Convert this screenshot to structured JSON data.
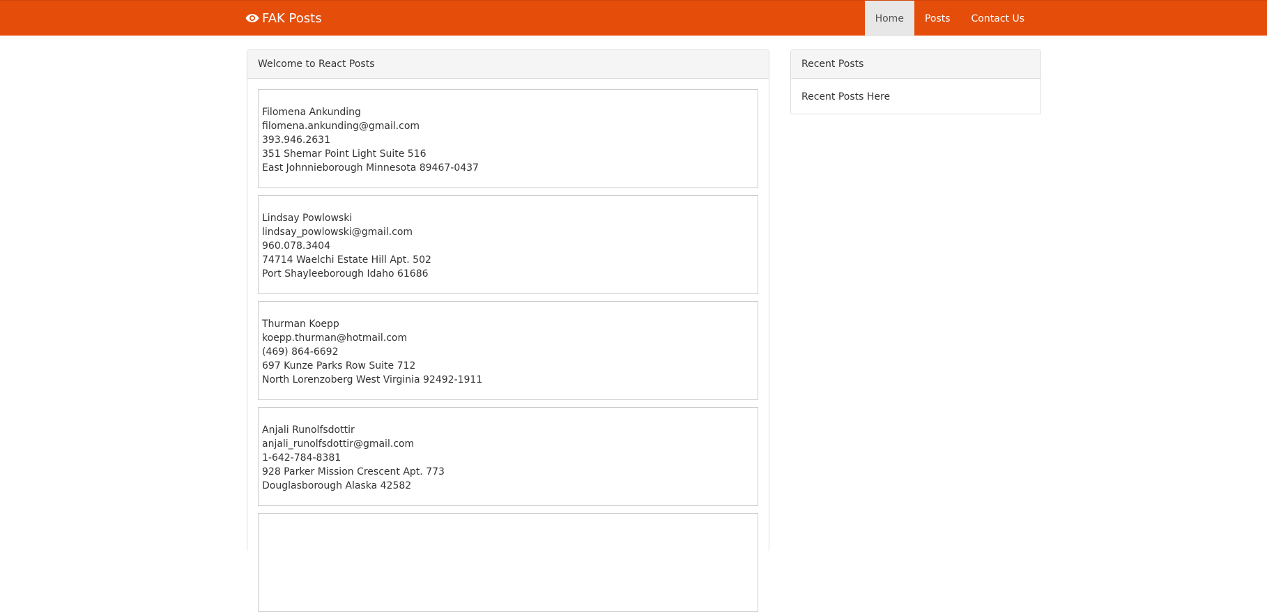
{
  "navbar": {
    "brand_label": "FAK Posts",
    "brand_icon": "eye-icon",
    "color": "#e44d0a",
    "items": [
      {
        "label": "Home",
        "active": true
      },
      {
        "label": "Posts",
        "active": false
      },
      {
        "label": "Contact Us",
        "active": false
      }
    ]
  },
  "main": {
    "heading": "Welcome to React Posts",
    "users": [
      {
        "name": "Filomena Ankunding",
        "email": "filomena.ankunding@gmail.com",
        "phone": "393.946.2631",
        "street": "351 Shemar Point Light Suite 516",
        "city_line": "East Johnnieborough Minnesota 89467-0437"
      },
      {
        "name": "Lindsay Powlowski",
        "email": "lindsay_powlowski@gmail.com",
        "phone": "960.078.3404",
        "street": "74714 Waelchi Estate Hill Apt. 502",
        "city_line": "Port Shayleeborough Idaho 61686"
      },
      {
        "name": "Thurman Koepp",
        "email": "koepp.thurman@hotmail.com",
        "phone": "(469) 864-6692",
        "street": "697 Kunze Parks Row Suite 712",
        "city_line": "North Lorenzoberg West Virginia 92492-1911"
      },
      {
        "name": "Anjali Runolfsdottir",
        "email": "anjali_runolfsdottir@gmail.com",
        "phone": "1-642-784-8381",
        "street": "928 Parker Mission Crescent Apt. 773",
        "city_line": "Douglasborough Alaska 42582"
      },
      {
        "name": "",
        "email": "",
        "phone": "",
        "street": "",
        "city_line": ""
      }
    ]
  },
  "sidebar": {
    "heading": "Recent Posts",
    "body": "Recent Posts Here"
  }
}
